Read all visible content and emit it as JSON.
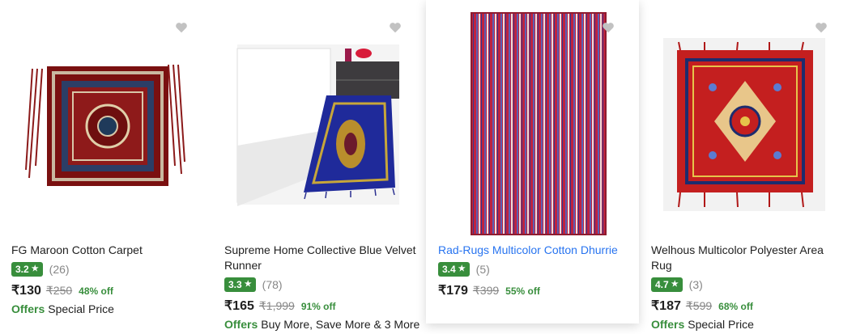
{
  "products": [
    {
      "title": "FG Maroon Cotton Carpet",
      "rating": "3.2",
      "reviews": "(26)",
      "price": "₹130",
      "mrp": "₹250",
      "discount": "48% off",
      "offers_label": "Offers",
      "offers_text": "Special Price"
    },
    {
      "title_line1": "Supreme Home Collective Blue Velvet",
      "title_line2": "Runner",
      "rating": "3.3",
      "reviews": "(78)",
      "price": "₹165",
      "mrp": "₹1,999",
      "discount": "91% off",
      "offers_label": "Offers",
      "offers_text": "Buy More, Save More & 3 More"
    },
    {
      "title": "Rad-Rugs Multicolor Cotton Dhurrie",
      "rating": "3.4",
      "reviews": "(5)",
      "price": "₹179",
      "mrp": "₹399",
      "discount": "55% off"
    },
    {
      "title_line1": "Welhous Multicolor Polyester Area",
      "title_line2": "Rug",
      "rating": "4.7",
      "reviews": "(3)",
      "price": "₹187",
      "mrp": "₹599",
      "discount": "68% off",
      "offers_label": "Offers",
      "offers_text": "Special Price"
    }
  ],
  "colors": {
    "rating_badge": "#388e3c",
    "link_blue": "#2874f0",
    "heart": "#c2c2c2"
  },
  "icons": {
    "wishlist": "heart-icon",
    "rating": "star-icon"
  }
}
